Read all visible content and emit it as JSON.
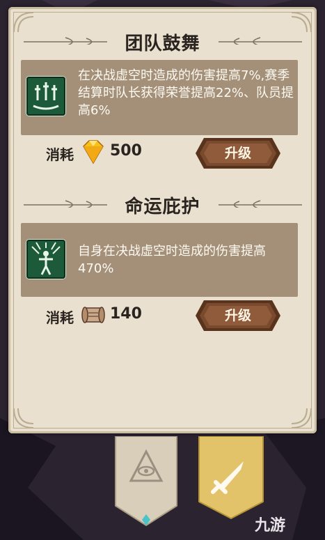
{
  "sections": [
    {
      "title": "团队鼓舞",
      "icon": "three-swords-icon",
      "description": "在决战虚空时造成的伤害提高7%,赛季结算时队长获得荣誉提高22%、队员提高6%",
      "cost_label": "消耗",
      "cost_icon": "diamond-gem-icon",
      "cost_value": "500",
      "button_label": "升级"
    },
    {
      "title": "命运庇护",
      "icon": "figure-radiance-icon",
      "description": "自身在决战虚空时造成的伤害提高470%",
      "cost_label": "消耗",
      "cost_icon": "scroll-icon",
      "cost_value": "140",
      "button_label": "升级"
    }
  ],
  "tabs": [
    {
      "icon": "eye-triangle-icon",
      "selected": false
    },
    {
      "icon": "sword-icon",
      "selected": true
    }
  ],
  "watermark": "九游",
  "colors": {
    "panel": "#e9e0cf",
    "desc_box": "#a48f78",
    "button": "#7a4a2e",
    "skill_icon_bg": "#1d5a3a",
    "tab_selected": "#e3c36a"
  }
}
